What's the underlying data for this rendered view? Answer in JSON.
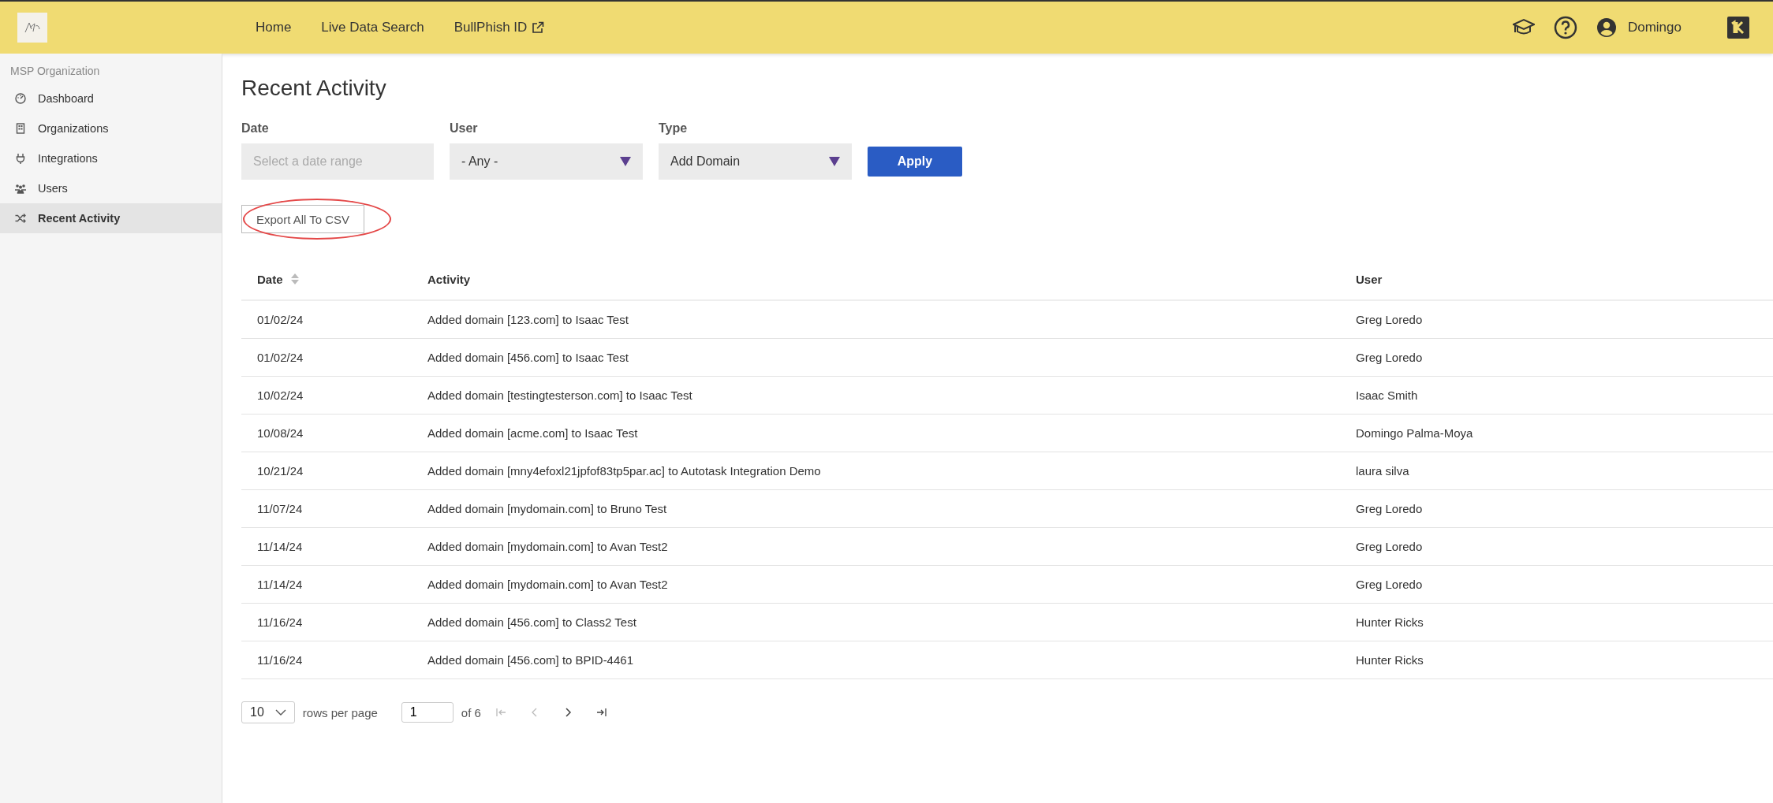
{
  "topbar": {
    "nav": [
      {
        "label": "Home",
        "external": false
      },
      {
        "label": "Live Data Search",
        "external": false
      },
      {
        "label": "BullPhish ID",
        "external": true
      }
    ],
    "user": "Domingo"
  },
  "sidebar": {
    "heading": "MSP Organization",
    "items": [
      {
        "label": "Dashboard",
        "selected": false
      },
      {
        "label": "Organizations",
        "selected": false
      },
      {
        "label": "Integrations",
        "selected": false
      },
      {
        "label": "Users",
        "selected": false
      },
      {
        "label": "Recent Activity",
        "selected": true
      }
    ]
  },
  "page": {
    "title": "Recent Activity"
  },
  "filters": [
    {
      "label": "Date",
      "kind": "input",
      "placeholder": "Select a date range"
    },
    {
      "label": "User",
      "kind": "select",
      "value": "- Any -"
    },
    {
      "label": "Type",
      "kind": "select",
      "value": "Add Domain"
    }
  ],
  "apply_button": "Apply",
  "export_button": {
    "label": "Export All To CSV",
    "highlighted": true
  },
  "table": {
    "columns": [
      {
        "label": "Date",
        "sortable": true
      },
      {
        "label": "Activity",
        "sortable": false
      },
      {
        "label": "User",
        "sortable": false
      }
    ],
    "rows": [
      [
        "01/02/24",
        "Added domain [123.com] to Isaac Test",
        "Greg Loredo"
      ],
      [
        "01/02/24",
        "Added domain [456.com] to Isaac Test",
        "Greg Loredo"
      ],
      [
        "10/02/24",
        "Added domain [testingtesterson.com] to Isaac Test",
        "Isaac Smith"
      ],
      [
        "10/08/24",
        "Added domain [acme.com] to Isaac Test",
        "Domingo Palma-Moya"
      ],
      [
        "10/21/24",
        "Added domain [mny4efoxl21jpfof83tp5par.ac] to Autotask Integration Demo",
        "laura silva"
      ],
      [
        "11/07/24",
        "Added domain [mydomain.com] to Bruno Test",
        "Greg Loredo"
      ],
      [
        "11/14/24",
        "Added domain [mydomain.com] to Avan Test2",
        "Greg Loredo"
      ],
      [
        "11/14/24",
        "Added domain [mydomain.com] to Avan Test2",
        "Greg Loredo"
      ],
      [
        "11/16/24",
        "Added domain [456.com] to Class2 Test",
        "Hunter Ricks"
      ],
      [
        "11/16/24",
        "Added domain [456.com] to BPID-4461",
        "Hunter Ricks"
      ]
    ]
  },
  "pagination": {
    "rows_per_page": "10",
    "rows_label": "rows per page",
    "page": "1",
    "of": "of 6"
  }
}
